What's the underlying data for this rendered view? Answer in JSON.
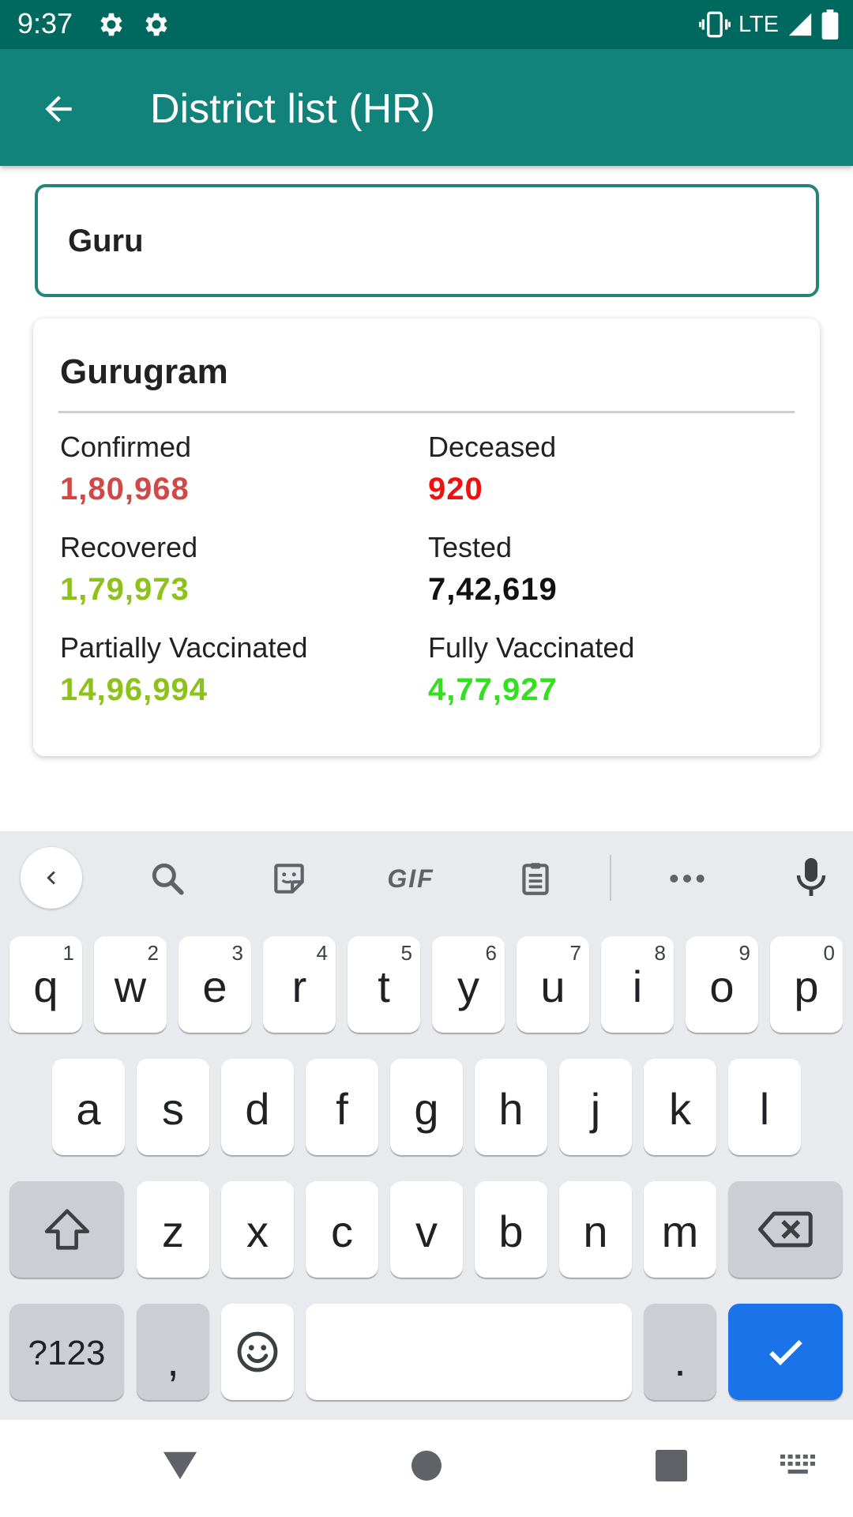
{
  "status_bar": {
    "time": "9:37",
    "network": "LTE",
    "icons": [
      "settings-gear-icon",
      "settings-gear-icon",
      "vibrate-icon",
      "signal-icon",
      "battery-icon"
    ]
  },
  "app_bar": {
    "title": "District list (HR)",
    "back_icon": "arrow-back-icon"
  },
  "search": {
    "value": "Guru",
    "accent_color": "#24847c"
  },
  "district_card": {
    "name": "Gurugram",
    "stats": [
      {
        "label": "Confirmed",
        "value": "1,80,968",
        "color": "#d04848"
      },
      {
        "label": "Deceased",
        "value": "920",
        "color": "#ee1111"
      },
      {
        "label": "Recovered",
        "value": "1,79,973",
        "color": "#8cc21a"
      },
      {
        "label": "Tested",
        "value": "7,42,619",
        "color": "#111111"
      },
      {
        "label": "Partially Vaccinated",
        "value": "14,96,994",
        "color": "#8cc21a"
      },
      {
        "label": "Fully Vaccinated",
        "value": "4,77,927",
        "color": "#33e01e"
      }
    ]
  },
  "keyboard": {
    "toolbar": {
      "gif_label": "GIF",
      "icons": [
        "chevron-left-icon",
        "search-icon",
        "sticker-icon",
        "gif-icon",
        "clipboard-icon",
        "more-icon",
        "mic-icon"
      ]
    },
    "row1": [
      {
        "ch": "q",
        "hint": "1"
      },
      {
        "ch": "w",
        "hint": "2"
      },
      {
        "ch": "e",
        "hint": "3"
      },
      {
        "ch": "r",
        "hint": "4"
      },
      {
        "ch": "t",
        "hint": "5"
      },
      {
        "ch": "y",
        "hint": "6"
      },
      {
        "ch": "u",
        "hint": "7"
      },
      {
        "ch": "i",
        "hint": "8"
      },
      {
        "ch": "o",
        "hint": "9"
      },
      {
        "ch": "p",
        "hint": "0"
      }
    ],
    "row2": [
      "a",
      "s",
      "d",
      "f",
      "g",
      "h",
      "j",
      "k",
      "l"
    ],
    "row3": [
      "z",
      "x",
      "c",
      "v",
      "b",
      "n",
      "m"
    ],
    "symbols_label": "?123",
    "comma": ",",
    "period": ".",
    "enter_color": "#1a73e8"
  },
  "nav_bar": {
    "icons": [
      "back-triangle-icon",
      "home-circle-icon",
      "recents-square-icon",
      "keyboard-switch-icon"
    ]
  }
}
